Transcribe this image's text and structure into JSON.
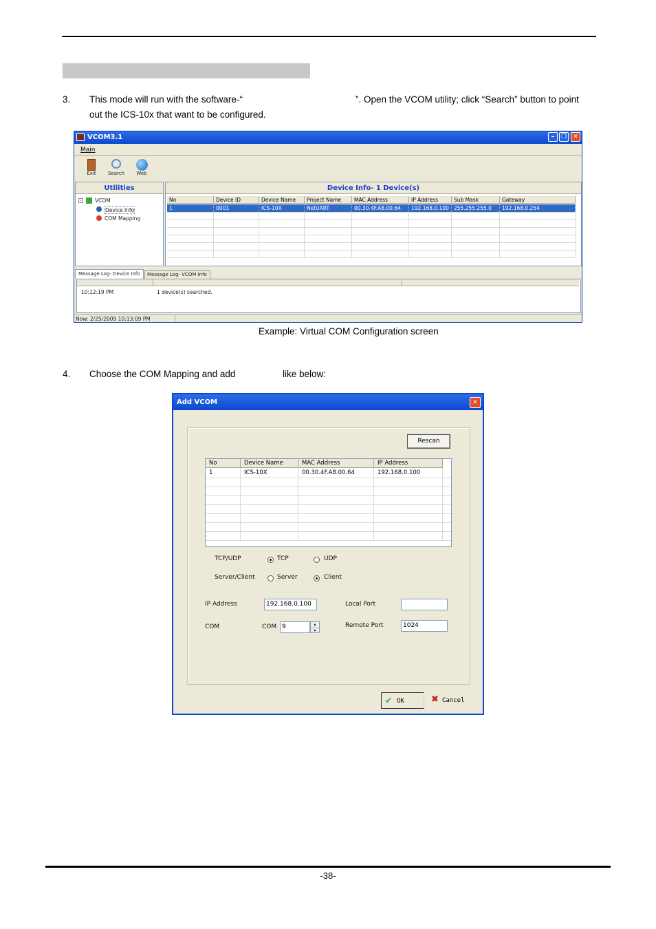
{
  "doc": {
    "step3_num": "3.",
    "step3_line1_a": "This mode will run with the software-“",
    "step3_line1_b": "”. Open the VCOM utility; click “Search” button to point",
    "step3_line2": "out the ICS-10x that want to be configured.",
    "caption1": "Example: Virtual COM Configuration screen",
    "step4_num": "4.",
    "step4_a": "Choose the COM Mapping and add",
    "step4_b": "like below:",
    "page_number": "-38-"
  },
  "vcom": {
    "title": "VCOM3.1",
    "menu_main": "Main",
    "toolbar": {
      "exit": "Exit",
      "search": "Search",
      "web": "Web"
    },
    "utilities_header": "Utilities",
    "tree": {
      "root": "VCOM",
      "device_info": "Device Info",
      "com_mapping": "COM Mapping"
    },
    "device_info_header": "Device Info- 1 Device(s)",
    "columns": [
      "No",
      "Device ID",
      "Device Name",
      "Project Name",
      "MAC Address",
      "IP Address",
      "Sub Mask",
      "Gateway"
    ],
    "row": [
      "1",
      "0001",
      "ICS-10X",
      "NetUART",
      "00.30.4F.A8.00.64",
      "192.168.0.100",
      "255.255.255.0",
      "192.168.0.254"
    ],
    "tabs": [
      "Message Log- Device Info",
      "Message Log- VCOM Info"
    ],
    "log_time": "10:12:19 PM",
    "log_msg": "1 device(s) searched.",
    "status": "Now: 2/25/2009 10:13:09 PM"
  },
  "addvcom": {
    "title": "Add VCOM",
    "rescan": "Rescan",
    "columns": [
      "No",
      "Device Name",
      "MAC Address",
      "IP Address"
    ],
    "row": [
      "1",
      "ICS-10X",
      "00.30.4F.A8.00.64",
      "192.168.0.100"
    ],
    "tcpudp_label": "TCP/UDP",
    "tcp": "TCP",
    "udp": "UDP",
    "serverclient_label": "Server/Client",
    "server": "Server",
    "client": "Client",
    "ip_label": "IP Address",
    "ip_value": "192.168.0.100",
    "local_port_label": "Local Port",
    "local_port_value": "",
    "com_label": "COM",
    "com_inner_label": "COM",
    "com_value": "9",
    "remote_port_label": "Remote Port",
    "remote_port_value": "1024",
    "ok": "OK",
    "cancel": "Cancel"
  }
}
